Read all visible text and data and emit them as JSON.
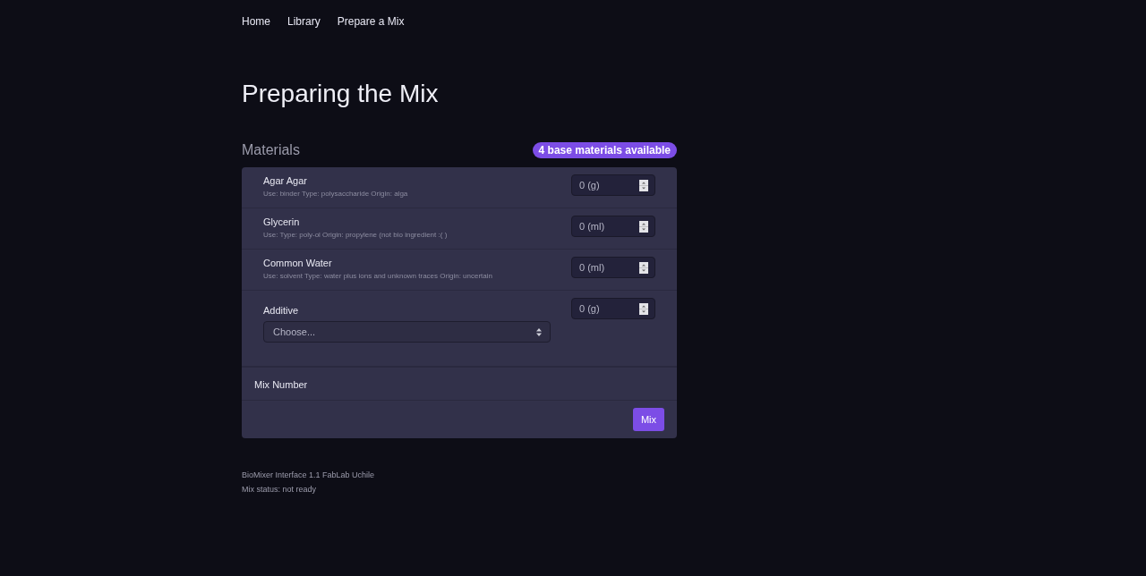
{
  "nav": [
    "Home",
    "Library",
    "Prepare a Mix"
  ],
  "title": "Preparing the Mix",
  "materials": {
    "heading": "Materials",
    "badge": "4 base materials available",
    "items": [
      {
        "kind": "material",
        "name": "Agar Agar",
        "description": "Use: binder Type: polysaccharide Origin: alga",
        "amount_placeholder": "0 (g)"
      },
      {
        "kind": "material",
        "name": "Glycerin",
        "description": "Use: Type: poly-ol Origin: propylene (not bio ingredient :( )",
        "amount_placeholder": "0 (ml)"
      },
      {
        "kind": "material",
        "name": "Common Water",
        "description": "Use: solvent Type: water plus ions and unknown traces Origin: uncertain",
        "amount_placeholder": "0 (ml)"
      },
      {
        "kind": "additive",
        "name": "Additive",
        "select_value": "Choose...",
        "amount_placeholder": "0 (g)"
      }
    ],
    "mix_number_label": "Mix Number",
    "mix_button": "Mix"
  },
  "footer": [
    "BioMixer Interface 1.1 FabLab Uchile",
    "Mix status: not ready"
  ]
}
